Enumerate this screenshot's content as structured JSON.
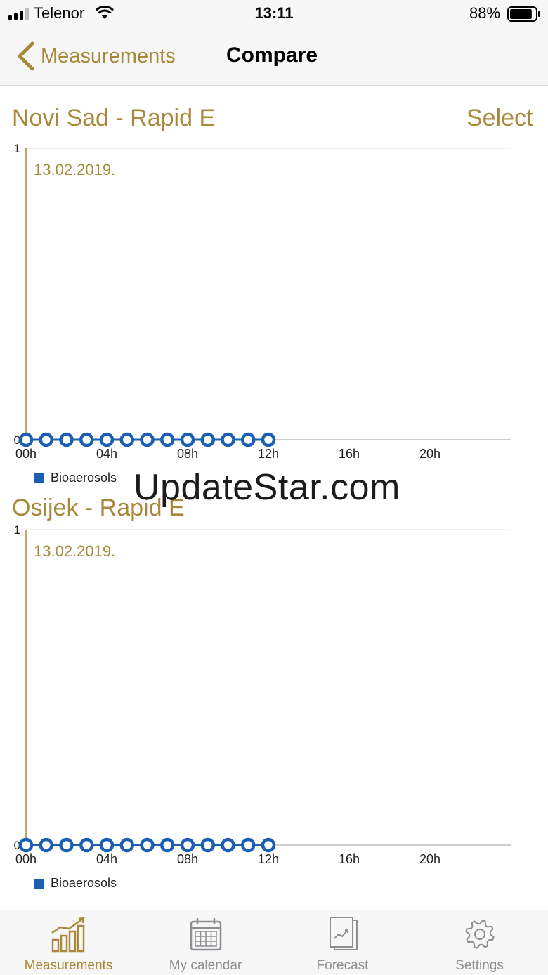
{
  "status_bar": {
    "carrier": "Telenor",
    "time": "13:11",
    "battery_percent": "88%",
    "battery_level": 0.88
  },
  "nav": {
    "back_label": "Measurements",
    "title": "Compare"
  },
  "select_label": "Select",
  "colors": {
    "accent": "#a8883a",
    "series": "#1a5fb4",
    "inactive": "#8e8e93"
  },
  "chart_data": [
    {
      "type": "line",
      "title": "Novi Sad - Rapid E",
      "date_label": "13.02.2019.",
      "y_ticks": [
        "1",
        "0"
      ],
      "ylim": [
        0,
        1
      ],
      "x_ticks": [
        "00h",
        "04h",
        "08h",
        "12h",
        "16h",
        "20h"
      ],
      "xlim": [
        0,
        24
      ],
      "grid": "horizontal",
      "legend": "bottom-left",
      "series": [
        {
          "name": "Bioaerosols",
          "color": "#1a5fb4",
          "x": [
            0,
            1,
            2,
            3,
            4,
            5,
            6,
            7,
            8,
            9,
            10,
            11,
            12
          ],
          "values": [
            0,
            0,
            0,
            0,
            0,
            0,
            0,
            0,
            0,
            0,
            0,
            0,
            0
          ]
        }
      ]
    },
    {
      "type": "line",
      "title": "Osijek - Rapid E",
      "date_label": "13.02.2019.",
      "y_ticks": [
        "1",
        "0"
      ],
      "ylim": [
        0,
        1
      ],
      "x_ticks": [
        "00h",
        "04h",
        "08h",
        "12h",
        "16h",
        "20h"
      ],
      "xlim": [
        0,
        24
      ],
      "grid": "horizontal",
      "legend": "bottom-left",
      "series": [
        {
          "name": "Bioaerosols",
          "color": "#1a5fb4",
          "x": [
            0,
            1,
            2,
            3,
            4,
            5,
            6,
            7,
            8,
            9,
            10,
            11,
            12
          ],
          "values": [
            0,
            0,
            0,
            0,
            0,
            0,
            0,
            0,
            0,
            0,
            0,
            0,
            0
          ]
        }
      ]
    }
  ],
  "watermark": "UpdateStar.com",
  "tabs": [
    {
      "label": "Measurements",
      "icon": "bar-chart-icon",
      "active": true
    },
    {
      "label": "My calendar",
      "icon": "calendar-icon",
      "active": false
    },
    {
      "label": "Forecast",
      "icon": "forecast-icon",
      "active": false
    },
    {
      "label": "Settings",
      "icon": "gear-icon",
      "active": false
    }
  ]
}
